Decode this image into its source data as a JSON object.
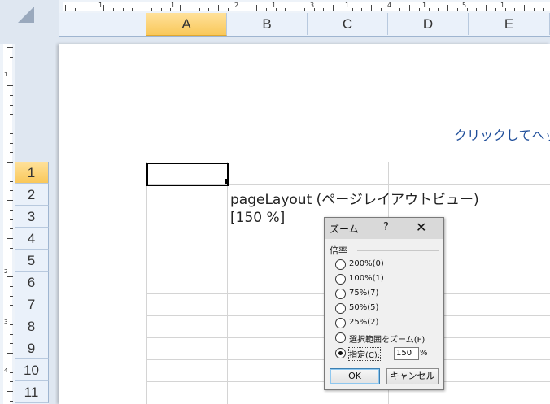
{
  "columns": [
    "A",
    "B",
    "C",
    "D",
    "E"
  ],
  "rows": [
    "1",
    "2",
    "3",
    "4",
    "5",
    "6",
    "7",
    "8",
    "9",
    "10",
    "11"
  ],
  "ruler": {
    "top_numbers": [
      "1",
      "1",
      "2",
      "1",
      "3",
      "1",
      "4",
      "1",
      "5",
      "1"
    ],
    "left_numbers": [
      "1",
      "2",
      "3",
      "4"
    ]
  },
  "page": {
    "header_hint": "クリックしてヘッ",
    "cell_b2": "pageLayout (ページレイアウトビュー)",
    "cell_b3": "[150 %]"
  },
  "dialog": {
    "title": "ズーム",
    "help": "?",
    "close": "✕",
    "group_label": "倍率",
    "options": [
      "200%(0)",
      "100%(1)",
      "75%(7)",
      "50%(5)",
      "25%(2)",
      "選択範囲をズーム(F)",
      "指定(C):"
    ],
    "selected_option": "指定(C):",
    "custom_value": "150",
    "percent_sign": "%",
    "ok_label": "OK",
    "cancel_label": "キャンセル"
  },
  "colors": {
    "selected_header": "#f9c85a",
    "header_bg": "#eaf1fa",
    "hint_text": "#1f4e9a"
  }
}
